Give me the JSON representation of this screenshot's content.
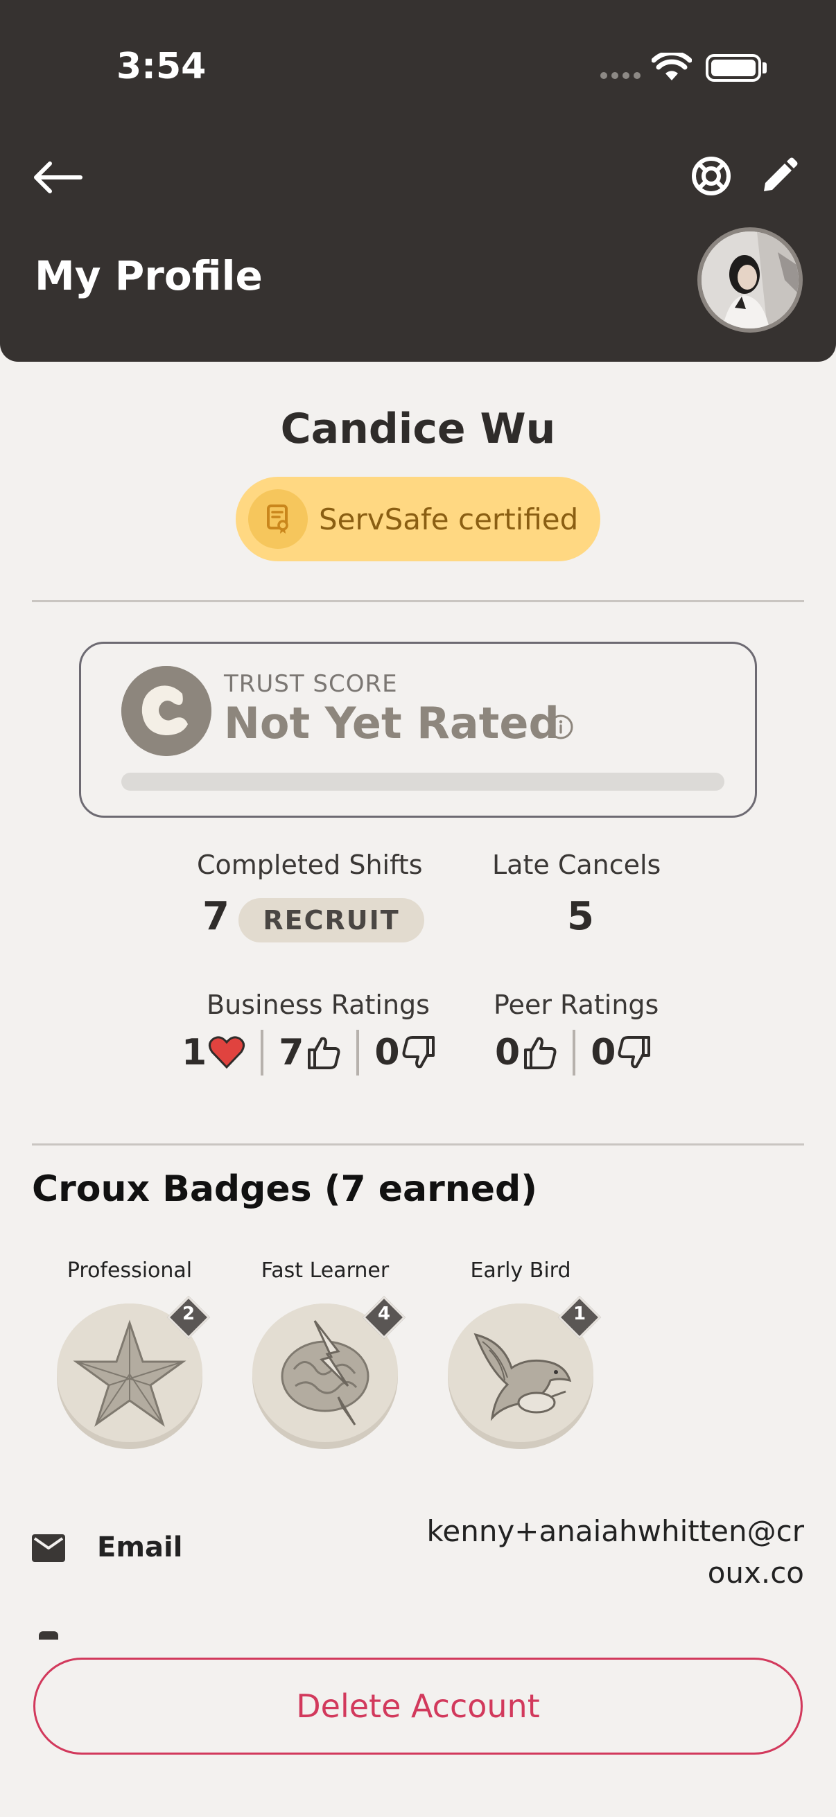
{
  "status_bar": {
    "time": "3:54"
  },
  "header": {
    "title": "My Profile"
  },
  "profile": {
    "name": "Candice Wu",
    "certification": "ServSafe certified"
  },
  "trust": {
    "label": "TRUST SCORE",
    "value": "Not Yet Rated"
  },
  "stats": {
    "completed_label": "Completed Shifts",
    "completed_value": "7",
    "level": "RECRUIT",
    "late_label": "Late Cancels",
    "late_value": "5",
    "business_label": "Business Ratings",
    "business_hearts": "1",
    "business_up": "7",
    "business_down": "0",
    "peer_label": "Peer Ratings",
    "peer_up": "0",
    "peer_down": "0"
  },
  "badges": {
    "title": "Croux Badges (7 earned)",
    "items": [
      {
        "name": "Professional",
        "count": "2",
        "icon": "star-icon"
      },
      {
        "name": "Fast Learner",
        "count": "4",
        "icon": "brain-lightning-icon"
      },
      {
        "name": "Early Bird",
        "count": "1",
        "icon": "swallow-bird-icon"
      }
    ]
  },
  "contact": {
    "email_label": "Email",
    "email_value": "kenny+anaiahwhitten@croux.co"
  },
  "actions": {
    "delete_label": "Delete Account"
  },
  "colors": {
    "header_bg": "#363230",
    "page_bg": "#f3f1ef",
    "cert_bg": "#ffd882",
    "cert_text": "#8a5e12",
    "danger": "#d2395c",
    "heart": "#e0433f"
  }
}
